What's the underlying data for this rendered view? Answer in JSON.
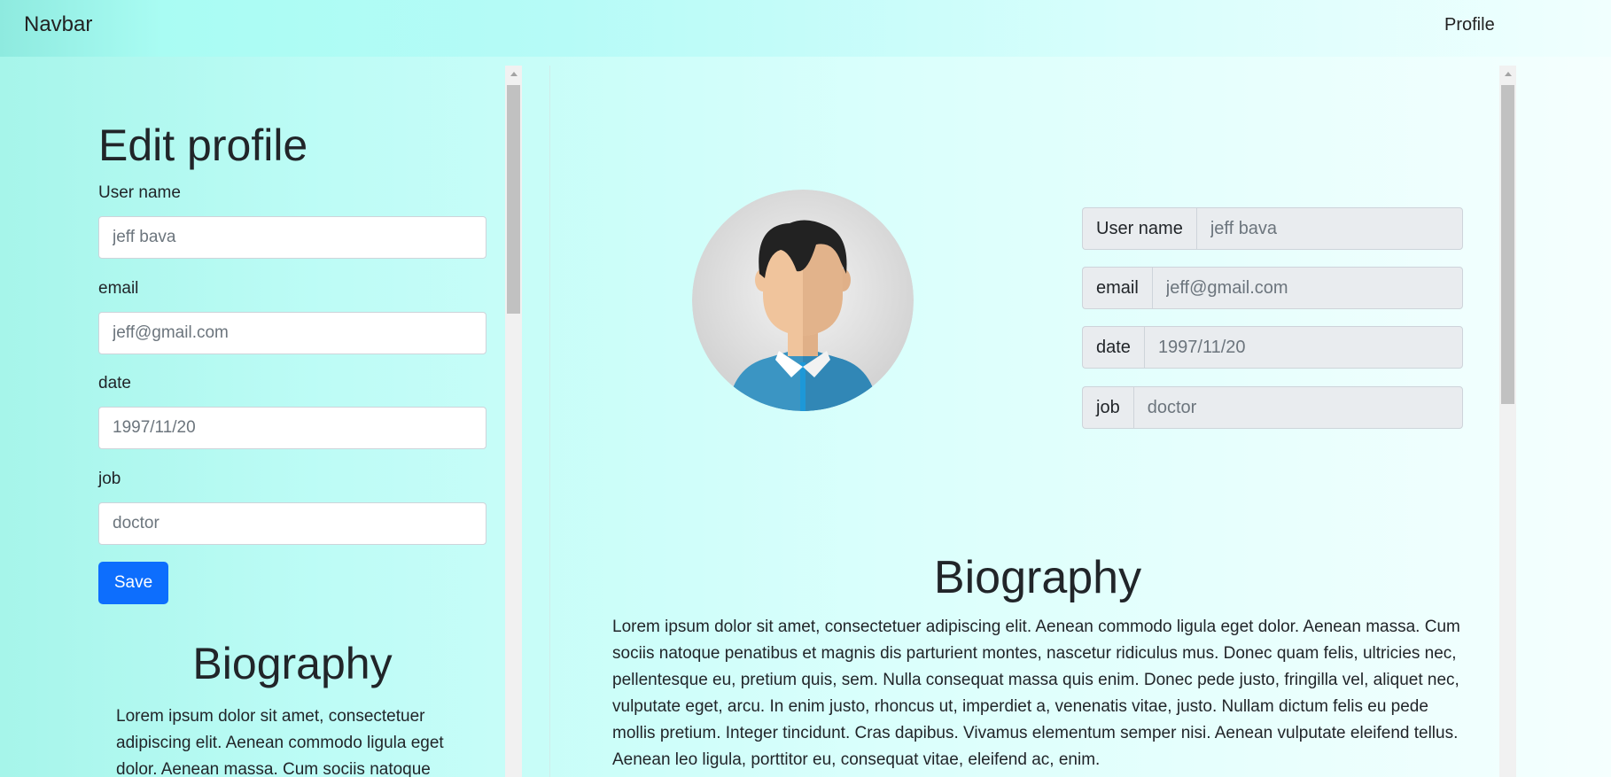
{
  "navbar": {
    "brand": "Navbar",
    "profile_link": "Profile"
  },
  "edit_form": {
    "title": "Edit profile",
    "fields": [
      {
        "label": "User name",
        "placeholder": "jeff bava"
      },
      {
        "label": "email",
        "placeholder": "jeff@gmail.com"
      },
      {
        "label": "date",
        "placeholder": "1997/11/20"
      },
      {
        "label": "job",
        "placeholder": "doctor"
      }
    ],
    "save_label": "Save"
  },
  "left_bio": {
    "title": "Biography",
    "text": "Lorem ipsum dolor sit amet, consectetuer adipiscing elit. Aenean commodo ligula eget dolor. Aenean massa. Cum sociis natoque"
  },
  "profile": {
    "avatar_icon": "user-avatar-icon",
    "fields": [
      {
        "label": "User name",
        "placeholder": "jeff bava"
      },
      {
        "label": "email",
        "placeholder": "jeff@gmail.com"
      },
      {
        "label": "date",
        "placeholder": "1997/11/20"
      },
      {
        "label": "job",
        "placeholder": "doctor"
      }
    ]
  },
  "right_bio": {
    "title": "Biography",
    "text": "Lorem ipsum dolor sit amet, consectetuer adipiscing elit. Aenean commodo ligula eget dolor. Aenean massa. Cum sociis natoque penatibus et magnis dis parturient montes, nascetur ridiculus mus. Donec quam felis, ultricies nec, pellentesque eu, pretium quis, sem. Nulla consequat massa quis enim. Donec pede justo, fringilla vel, aliquet nec, vulputate eget, arcu. In enim justo, rhoncus ut, imperdiet a, venenatis vitae, justo. Nullam dictum felis eu pede mollis pretium. Integer tincidunt. Cras dapibus. Vivamus elementum semper nisi. Aenean vulputate eleifend tellus. Aenean leo ligula, porttitor eu, consequat vitae, eleifend ac, enim."
  },
  "colors": {
    "primary_button": "#0d6efd",
    "addon_bg": "#e9ecef"
  }
}
